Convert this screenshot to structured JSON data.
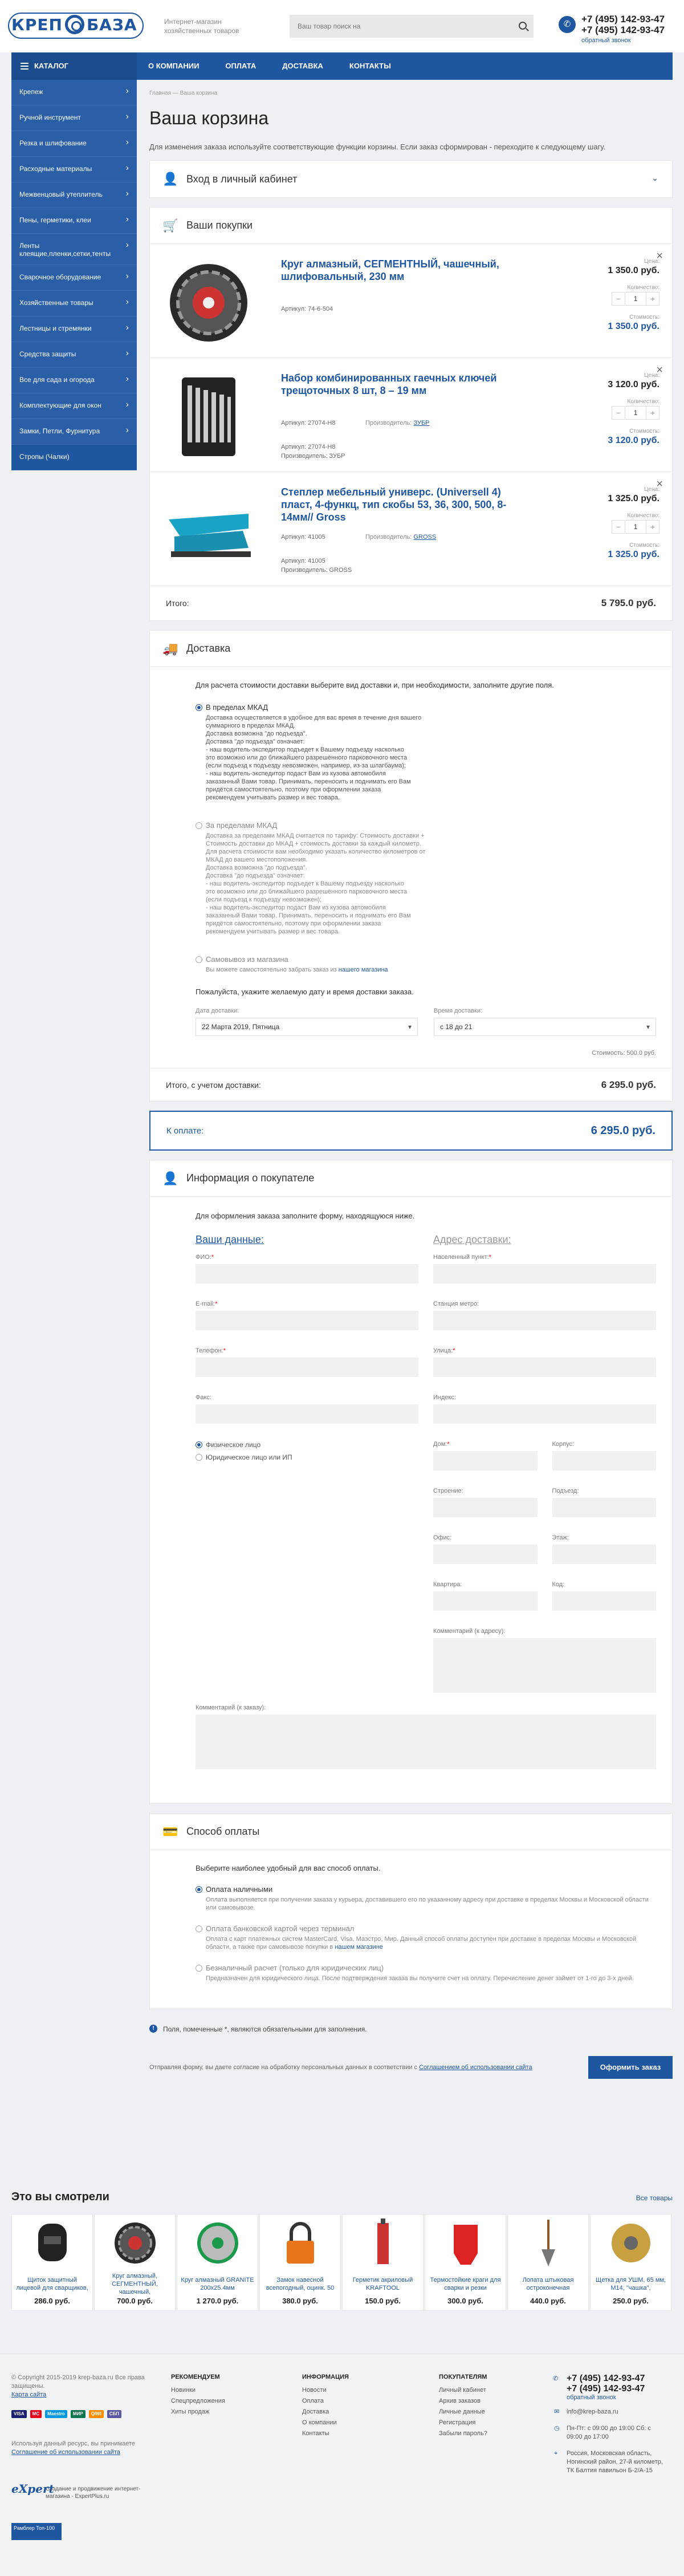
{
  "header": {
    "logo_left": "КРЕП",
    "logo_right": "БАЗА",
    "tagline": "Интернет-магазин хозяйственных товаров",
    "search_placeholder": "Ваш товар поиск на",
    "phone1": "+7 (495) 142-93-47",
    "phone2": "+7 (495) 142-93-47",
    "callback": "обратный звонок"
  },
  "nav": {
    "catalog": "КАТАЛОГ",
    "links": [
      "О КОМПАНИИ",
      "ОПЛАТА",
      "ДОСТАВКА",
      "КОНТАКТЫ"
    ]
  },
  "sidebar": [
    "Крепеж",
    "Ручной инструмент",
    "Резка и шлифование",
    "Расходные материалы",
    "Межвенцовый утеплитель",
    "Пены, герметики, клеи",
    "Ленты клеящие,пленки,сетки,тенты",
    "Сварочное оборудование",
    "Хозяйственные товары",
    "Лестницы и стремянки",
    "Средства защиты",
    "Все для сада и огорода",
    "Комплектующие для окон",
    "Замки, Петли, Фурнитура",
    "Стропы (Чалки)"
  ],
  "breadcrumbs": "Главная  —  Ваша корзина",
  "page_title": "Ваша корзина",
  "intro": "Для изменения заказа используйте соответствующие функции корзины. Если заказ сформирован - переходите к следующему шагу.",
  "login_title": "Вход в личный кабинет",
  "cart": {
    "title": "Ваши покупки",
    "price_label": "Цена:",
    "qty_label": "Количество:",
    "cost_label": "Стоимость:",
    "art_label": "Артикул:",
    "man_label": "Производитель:",
    "items": [
      {
        "name": "Круг алмазный, СЕГМЕНТНЫЙ, чашечный, шлифовальный, 230 мм",
        "art": "74-6-504",
        "art2": "",
        "manufacturer": "",
        "manufacturer2": "",
        "price": "1 350.0 руб.",
        "qty": "1",
        "cost": "1 350.0 руб."
      },
      {
        "name": "Набор комбинированных гаечных ключей трещоточных 8 шт, 8 – 19 мм",
        "art": "27074-H8",
        "art2": "27074-H8",
        "manufacturer": "ЗУБР",
        "manufacturer2": "ЗУБР",
        "price": "3 120.0 руб.",
        "qty": "1",
        "cost": "3 120.0 руб."
      },
      {
        "name": "Степлер мебельный универс. (Universell 4) пласт, 4-функц, тип скобы 53, 36, 300, 500, 8-14мм// Gross",
        "art": "41005",
        "art2": "41005",
        "manufacturer": "GROSS",
        "manufacturer2": "GROSS",
        "price": "1 325.0 руб.",
        "qty": "1",
        "cost": "1 325.0 руб."
      }
    ],
    "total_label": "Итого:",
    "total": "5 795.0 руб."
  },
  "delivery": {
    "title": "Доставка",
    "question": "Для расчета стоимости доставки выберите вид доставки и, при необходимости, заполните другие поля.",
    "options": [
      {
        "title": "В пределах МКАД",
        "text": "Доставка осуществляется в удобное для вас время в течение дня вашего\nсуммарного в пределах МКАД.\nДоставка возможна \"до подъезда\".\nДоставка \"до подъезда\" означает:\n- наш водитель-экспедитор подъедет к Вашему подъезду насколько\nэто возможно или до ближайшего разрешённого парковочного места\n(если подъезд к подъезду невозможен, например, из-за шлагбаума);\n- наш водитель-экспедитор подаст Вам из кузова автомобиля\nзаказанный Вами товар. Принимать, переносить и поднимать его Вам\nпридётся самостоятельно, поэтому при оформлении заказа\nрекомендуем учитывать размер и вес товара."
      },
      {
        "title": "За пределами МКАД",
        "text": "Доставка за пределами МКАД считается по тарифу: Стоимость доставки +\nСтоимость доставки до МКАД + стоимость доставки за каждый километр.\nДля расчета стоимости вам необходимо указать количество километров от\nМКАД до вашего местоположения.\nДоставка возможна \"до подъезда\".\nДоставка \"до подъезда\" означает:\n- наш водитель-экспедитор подъедет к Вашему подъезду насколько\nэто возможно или до ближайшего разрешённого парковочного места\n(если подъезд к подъезду невозможен);\n- наш водитель-экспедитор подаст Вам из кузова автомобиля\nзаказанный Вами товар. Принимать, переносить и поднимать его Вам\nпридётся самостоятельно, поэтому при оформлении заказа\nрекомендуем учитывать размер и вес товара."
      },
      {
        "title": "Самовывоз из магазина",
        "text": "Вы можете самостоятельно забрать заказ из",
        "link": "нашего магазина"
      }
    ],
    "time_prompt": "Пожалуйста, укажите желаемую дату и время доставки заказа.",
    "date_label": "Дата доставки:",
    "date_value": "22 Марта 2019, Пятница",
    "time_label": "Время доставки:",
    "time_value": "с 18 до 21",
    "cost": "Стоимость: 500.0 руб.",
    "with_delivery_label": "Итого, с учетом доставки:",
    "with_delivery": "6 295.0 руб."
  },
  "to_pay": {
    "label": "К оплате:",
    "value": "6 295.0 руб."
  },
  "buyer": {
    "title": "Информация о покупателе",
    "question": "Для оформления заказа заполните форму, находящуюся ниже.",
    "col1": "Ваши данные:",
    "col2": "Адрес доставки:",
    "fio": "ФИО:",
    "email": "E-mail:",
    "phone": "Телефон:",
    "fax": "Факс:",
    "person1": "Физическое лицо",
    "person2": "Юридическое лицо или ИП",
    "city": "Населенный пункт:",
    "station": "Станция метро:",
    "street": "Улица:",
    "index": "Индекс:",
    "house": "Дом:",
    "korpus": "Корпус:",
    "building": "Строение:",
    "entrance": "Подъезд:",
    "office": "Офис:",
    "floor": "Этаж:",
    "flat": "Квартира:",
    "code": "Код:",
    "comment_addr": "Комментарий (к адресу):",
    "comment_order": "Комментарий (к заказу):"
  },
  "payment": {
    "title": "Способ оплаты",
    "question": "Выберите наиболее удобный для вас способ оплаты.",
    "options": [
      {
        "title": "Оплата наличными",
        "text": "Оплата выполняется при получении заказа у курьера, доставившего его по указанному адресу при доставке в пределах Москвы и Московской области или самовывозе."
      },
      {
        "title": "Оплата банковской картой через терминал",
        "text": "Оплата с карт платёжных систем MasterCard, Visa, Маэстро, Мир. Данный способ оплаты доступен при доставке в пределах Москвы и Московской области, а также при самовывозе покупки в",
        "link": "нашем магазине"
      },
      {
        "title": "Безналичный расчет (только для юридических лиц)",
        "text": "Предназначен для юридического лица. После подтверждения заказа вы получите счет на оплату. Перечисление денег займет от 1-го до 3-х дней."
      }
    ]
  },
  "required_note": "Поля, помеченные *, являются обязательными для заполнения.",
  "agree_text": "Отправляя форму, вы даете согласие на обработку персональных данных в соответствии с",
  "agree_link": "Соглашением об использовании сайта",
  "submit": "Оформить заказ",
  "watched": {
    "title": "Это вы смотрели",
    "all": "Все товары",
    "items": [
      {
        "name": "Щиток защитный лицевой для сварщиков,",
        "price": "286.0 руб."
      },
      {
        "name": "Круг алмазный, СЕГМЕНТНЫЙ, чашечный,",
        "price": "700.0 руб."
      },
      {
        "name": "Круг алмазный GRANITE 200x25.4мм",
        "price": "1 270.0 руб."
      },
      {
        "name": "Замок навесной всепогодный, оцинк. 50",
        "price": "380.0 руб."
      },
      {
        "name": "Герметик акриловый KRAFTOOL",
        "price": "150.0 руб."
      },
      {
        "name": "Термостойкие краги для сварки и резки",
        "price": "300.0 руб."
      },
      {
        "name": "Лопата штыковая остроконечная",
        "price": "440.0 руб."
      },
      {
        "name": "Щетка для УШМ, 65 мм, М14, \"чашка\",",
        "price": "250.0 руб."
      }
    ]
  },
  "footer": {
    "copyright": "© Copyright 2015-2019 krep-baza.ru Все права защищены.",
    "sitemap": "Карта сайта",
    "disclaimer": "Используя данный ресурс, вы принимаете",
    "disclaimer_link": "Соглашение об использовании сайта",
    "cards": [
      "VISA",
      "MC",
      "Maestro",
      "МИР",
      "QIWI",
      "СБП"
    ],
    "expert_text": "Создание и продвижение интернет-магазина - ExpertPlus.ru",
    "expert_logo": "eXpert",
    "rambler": "Рамблер Топ-100",
    "cols": [
      {
        "title": "Рекомендуем",
        "items": [
          "Новинки",
          "Спецпредложения",
          "Хиты продаж"
        ]
      },
      {
        "title": "Информация",
        "items": [
          "Новости",
          "Оплата",
          "Доставка",
          "О компании",
          "Контакты"
        ]
      },
      {
        "title": "Покупателям",
        "items": [
          "Личный кабинет",
          "Архив заказов",
          "Личные данные",
          "Регистрация",
          "Забыли пароль?"
        ]
      }
    ],
    "phone1": "+7 (495) 142-93-47",
    "phone2": "+7 (495) 142-93-47",
    "callback": "обратный звонок",
    "email": "info@krep-baza.ru",
    "hours": "Пн-Пт: с 09:00 до 19:00 Сб: с 09:00 до 17:00",
    "address": "Россия, Московская область, Ногинский район, 27-й километр, ТК Балтия павильон Б-2/А-15"
  }
}
